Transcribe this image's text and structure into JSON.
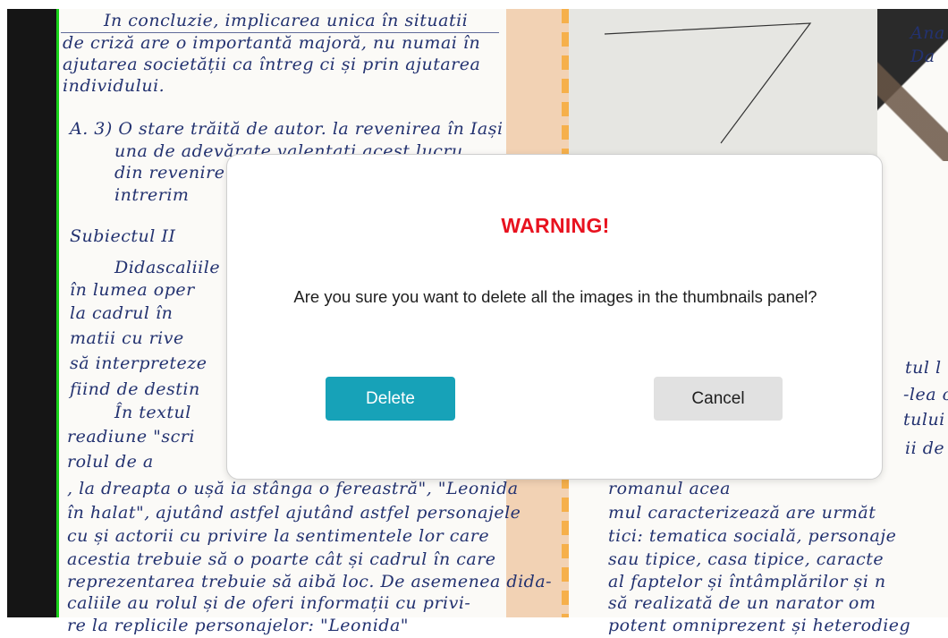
{
  "dialog": {
    "title": "WARNING!",
    "message": "Are you sure you want to delete all the images in the thumbnails panel?",
    "delete_label": "Delete",
    "cancel_label": "Cancel"
  },
  "colors": {
    "warning": "#e8121f",
    "delete_button": "#17a2b8",
    "cancel_button": "#e1e1e1",
    "edge_marker": "#19d219"
  },
  "background": {
    "lines": [
      {
        "text": "In concluzie, implicarea unica în situatii"
      },
      {
        "text": "de criză are o importantă majoră, nu numai în"
      },
      {
        "text": "ajutarea societății ca întreg ci și prin ajutarea"
      },
      {
        "text": "individului."
      },
      {
        "text": "A. 3) O stare trăită de autor. la revenirea în Iași"
      },
      {
        "text": "una de adevărate valentati acest lucru"
      },
      {
        "text": "din revenire"
      },
      {
        "text": "intrerim"
      },
      {
        "text": "Subiectul II"
      },
      {
        "text": "Didascaliile"
      },
      {
        "text": "în lumea oper"
      },
      {
        "text": "la cadrul în"
      },
      {
        "text": "matii cu rive"
      },
      {
        "text": "să interpreteze"
      },
      {
        "text": "fiind de destin"
      },
      {
        "text": "În textul"
      },
      {
        "text": "readiune \"scri"
      },
      {
        "text": "rolul de a"
      },
      {
        "text": ", la dreapta o ușă ia stânga o fereastră\", \"Leonida"
      },
      {
        "text": "în halat\", ajutând astfel ajutând astfel personajele"
      },
      {
        "text": "cu și actorii cu privire la sentimentele lor care"
      },
      {
        "text": "acestia trebuie să o poarte cât și cadrul în care"
      },
      {
        "text": "reprezentarea trebuie să aibă loc. De asemenea dida-"
      },
      {
        "text": "caliile au rolul și de oferi informații cu privi-"
      },
      {
        "text": "re la replicile personajelor: \"Leonida\""
      },
      {
        "text": "tul l"
      },
      {
        "text": "-lea c"
      },
      {
        "text": "tului"
      },
      {
        "text": "ii de"
      },
      {
        "text": "romanul acea"
      },
      {
        "text": "mul caracterizează are următ"
      },
      {
        "text": "tici: tematica socială, personaje"
      },
      {
        "text": "sau tipice, casa tipice, caracte"
      },
      {
        "text": "al faptelor și întâmplărilor și n"
      },
      {
        "text": "să realizată de un narator om"
      },
      {
        "text": "potent omniprezent și heterodieg"
      },
      {
        "text": "Ana"
      },
      {
        "text": "Da"
      }
    ]
  }
}
